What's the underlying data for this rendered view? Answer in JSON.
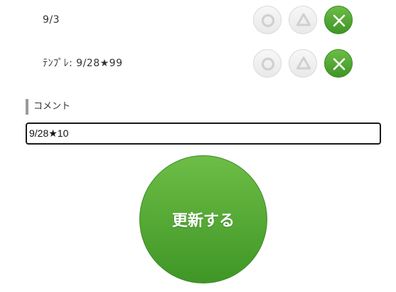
{
  "rows": [
    {
      "label": "9/3",
      "selected": "cross"
    },
    {
      "label": "ﾃﾝﾌﾟﾚ: 9/28★99",
      "selected": "cross"
    }
  ],
  "choices": {
    "circle_icon": "circle-icon",
    "triangle_icon": "triangle-icon",
    "cross_icon": "cross-icon"
  },
  "comment": {
    "heading": "コメント",
    "value": "9/28★10"
  },
  "submit": {
    "label": "更新する"
  },
  "colors": {
    "selected_green": "#4ea52f",
    "unselected_gray": "#eeeeee",
    "heading_bar": "#9a9a9a"
  }
}
